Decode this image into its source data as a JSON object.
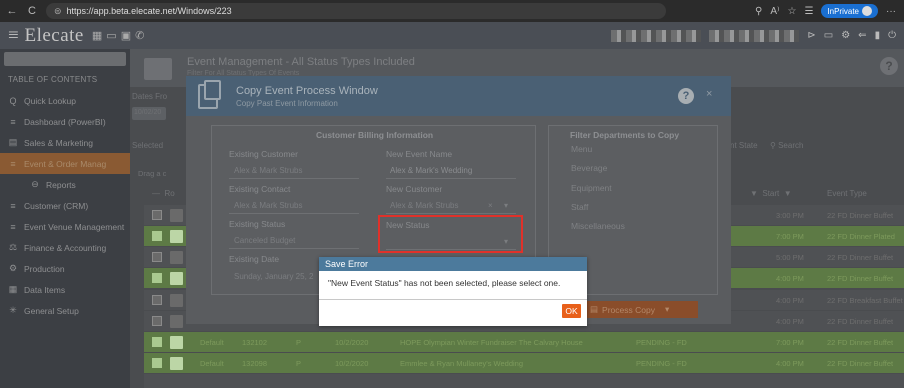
{
  "browser": {
    "back": "←",
    "refresh": "C",
    "url": "https://app.beta.elecate.net/Windows/223",
    "inprivate_label": "InPrivate",
    "more": "···"
  },
  "app": {
    "logo": "Elecate",
    "icons": [
      "calendar-icon",
      "chat-icon",
      "grid-icon",
      "phone-icon"
    ]
  },
  "sidebar": {
    "title": "TABLE OF CONTENTS",
    "items": [
      {
        "label": "Quick Lookup",
        "icon": "Q"
      },
      {
        "label": "Dashboard (PowerBI)",
        "icon": "≡"
      },
      {
        "label": "Sales & Marketing",
        "icon": "▤"
      },
      {
        "label": "Event & Order Manag",
        "icon": "≡"
      },
      {
        "label": "Reports",
        "icon": "⊖"
      },
      {
        "label": "Customer (CRM)",
        "icon": "≡"
      },
      {
        "label": "Event Venue Management",
        "icon": "≡"
      },
      {
        "label": "Finance & Accounting",
        "icon": "⚖"
      },
      {
        "label": "Production",
        "icon": "⚙"
      },
      {
        "label": "Data Items",
        "icon": "▦"
      },
      {
        "label": "General Setup",
        "icon": "✳"
      }
    ]
  },
  "main": {
    "title": "Event Management - All Status Types Included",
    "sub": "Filter For All Status Types Of Events",
    "bg_labels": {
      "dates_from": "Dates Fro",
      "date_val": "10/02/20",
      "selected": "Selected",
      "drag": "Drag a c",
      "status_col": "nt State",
      "search": "Search",
      "start_col": "Start",
      "event_type_col": "Event Type"
    },
    "rows": [
      {
        "style": "gray",
        "start": "3:00 PM",
        "type": "22 FD Dinner Buffet"
      },
      {
        "style": "green",
        "start": "7:00 PM",
        "type": "22 FD Dinner Plated"
      },
      {
        "style": "gray",
        "start": "5:00 PM",
        "type": "22 FD Dinner Buffet"
      },
      {
        "style": "green",
        "start": "4:00 PM",
        "type": "22 FD Dinner Buffet"
      },
      {
        "style": "gray",
        "start": "4:00 PM",
        "type": "22 FD Breakfast Buffet"
      },
      {
        "style": "gray",
        "start": "4:00 PM",
        "type": "22 FD Dinner Buffet"
      },
      {
        "style": "green",
        "start": "7:00 PM",
        "type": "22 FD Dinner Buffet",
        "c1": "Default",
        "c2": "132102",
        "c3": "P",
        "c4": "10/2/2020",
        "c5": "HOPE Olympian Winter Fundraiser The Calvary House",
        "c6": "PENDING - FD"
      },
      {
        "style": "green",
        "start": "4:00 PM",
        "type": "22 FD Dinner Buffet",
        "c1": "Default",
        "c2": "132098",
        "c3": "P",
        "c4": "10/2/2020",
        "c5": "Emmlee & Ryan Mullaney's Wedding",
        "c6": "PENDING - FD"
      }
    ]
  },
  "dialog": {
    "title": "Copy Event Process Window",
    "subtitle": "Copy Past Event Information",
    "help": "?",
    "close": "×",
    "billing_title": "Customer Billing Information",
    "filter_title": "Filter Departments to Copy",
    "existing_customer_label": "Existing Customer",
    "existing_customer_val": "Alex & Mark Strubs",
    "existing_contact_label": "Existing Contact",
    "existing_contact_val": "Alex & Mark Strubs",
    "existing_status_label": "Existing Status",
    "existing_status_val": "Canceled Budget",
    "existing_date_label": "Existing Date",
    "existing_date_val": "Sunday, January 25, 2",
    "new_event_name_label": "New Event Name",
    "new_event_name_val": "Alex & Mark's Wedding",
    "new_customer_label": "New Customer",
    "new_customer_val": "Alex & Mark Strubs",
    "new_status_label": "New Status",
    "new_status_val": "",
    "departments": [
      "Menu",
      "Beverage",
      "Equipment",
      "Staff",
      "Miscellaneous"
    ],
    "process_label": "Process Copy"
  },
  "save_error": {
    "title": "Save Error",
    "message": "\"New Event Status\" has not been selected, please select one.",
    "ok": "OK"
  }
}
